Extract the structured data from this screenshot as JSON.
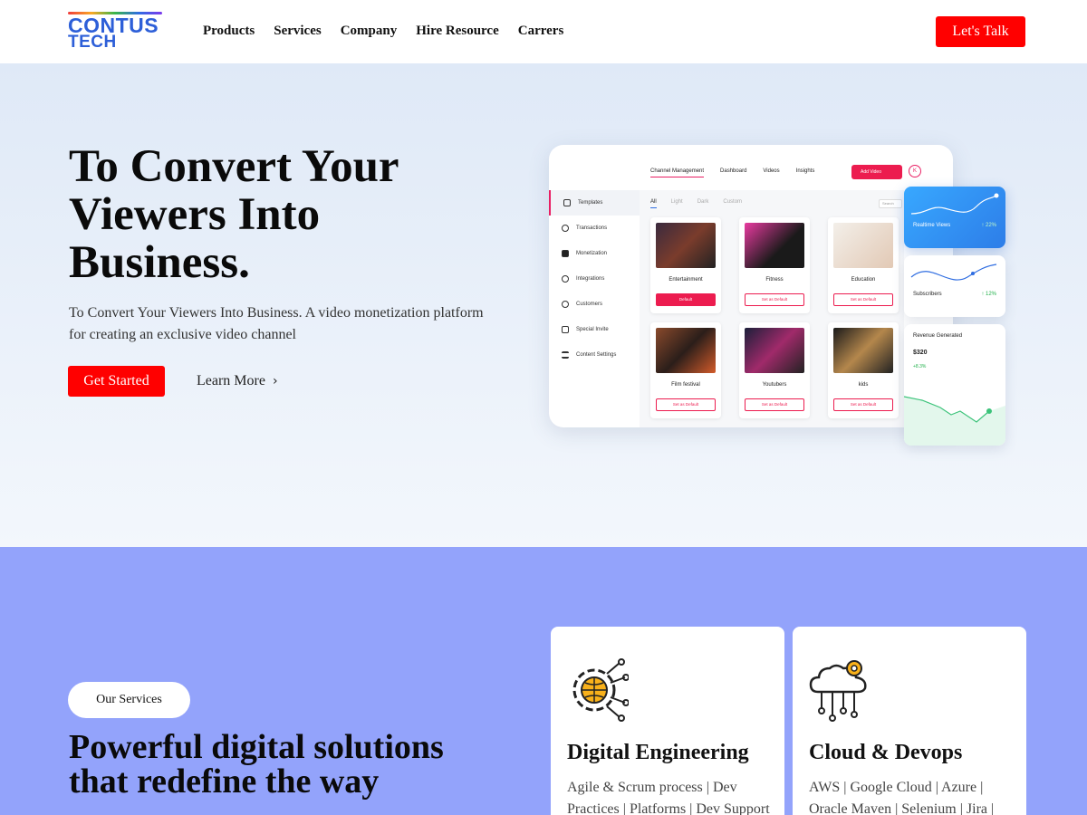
{
  "nav": {
    "logo_line1": "CONTUS",
    "logo_line2": "TECH",
    "menu": [
      "Products",
      "Services",
      "Company",
      "Hire Resource",
      "Carrers"
    ],
    "cta": "Let's Talk"
  },
  "hero": {
    "title": "To Convert Your Viewers Into Business.",
    "subtitle": "To Convert Your Viewers Into Business. A video monetization platform for creating an exclusive video channel",
    "primary_button": "Get Started",
    "secondary_link": "Learn More"
  },
  "dashboard": {
    "tabs": [
      "Channel Management",
      "Dashboard",
      "Videos",
      "Insights"
    ],
    "add_button": "Add Video",
    "avatar": "K",
    "sidebar": [
      "Templates",
      "Transactions",
      "Monetization",
      "Integrations",
      "Customers",
      "Special Invite",
      "Content Settings"
    ],
    "filters": [
      "All",
      "Light",
      "Dark",
      "Custom"
    ],
    "search": "Search",
    "cards": [
      {
        "label": "Entertainment",
        "button": "Default"
      },
      {
        "label": "Fitness",
        "button": "Set as Default"
      },
      {
        "label": "Education",
        "button": "Set as Default"
      },
      {
        "label": "Film festival",
        "button": "Set as Default"
      },
      {
        "label": "Youtubers",
        "button": "Set as Default"
      },
      {
        "label": "kids",
        "button": "Set as Default"
      }
    ],
    "widgets": {
      "realtime_label": "Realtime Views",
      "realtime_pct": "↑ 22%",
      "subs_label": "Subscribers",
      "subs_pct": "↑ 12%",
      "revenue_label": "Revenue Generated",
      "revenue_value": "$320",
      "revenue_delta": "+8.3%"
    }
  },
  "services": {
    "pill": "Our Services",
    "heading": "Powerful digital solutions that redefine the way",
    "cards": [
      {
        "title": "Digital Engineering",
        "desc": "Agile & Scrum process | Dev Practices | Platforms | Dev Support"
      },
      {
        "title": "Cloud & Devops",
        "desc": "AWS | Google Cloud | Azure | Oracle Maven | Selenium | Jira |"
      }
    ]
  },
  "colors": {
    "accent": "#ff0000",
    "brand": "#2d5fd8",
    "services_bg": "#93a3fb",
    "dash_accent": "#ec1c4f"
  }
}
